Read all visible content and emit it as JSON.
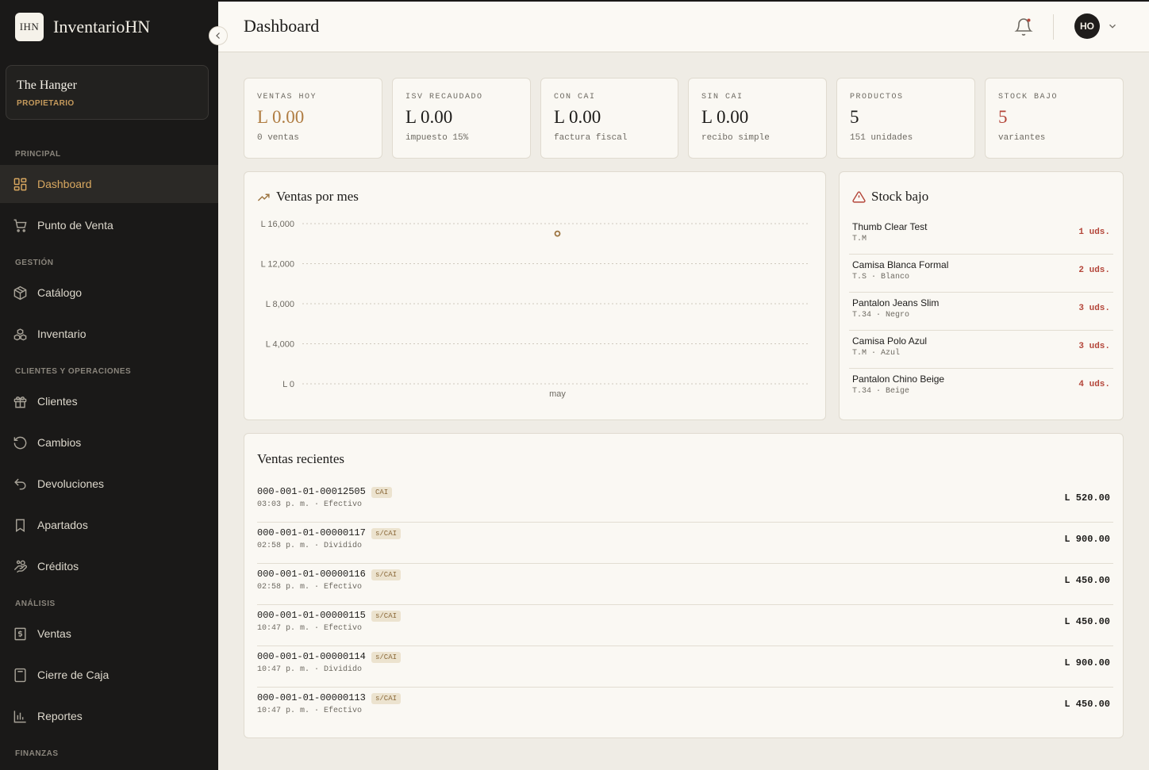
{
  "brand": {
    "logo_text": "IHN",
    "name": "InventarioHN"
  },
  "store": {
    "name": "The Hanger",
    "role": "PROPIETARIO"
  },
  "sidebar": {
    "sections": [
      {
        "label": "PRINCIPAL"
      },
      {
        "label": "GESTIÓN"
      },
      {
        "label": "CLIENTES Y OPERACIONES"
      },
      {
        "label": "ANÁLISIS"
      },
      {
        "label": "FINANZAS"
      }
    ],
    "items": [
      {
        "label": "Dashboard",
        "icon": "dashboard-icon",
        "active": true
      },
      {
        "label": "Punto de Venta",
        "icon": "cart-icon"
      },
      {
        "label": "Catálogo",
        "icon": "package-icon"
      },
      {
        "label": "Inventario",
        "icon": "boxes-icon"
      },
      {
        "label": "Clientes",
        "icon": "gift-icon"
      },
      {
        "label": "Cambios",
        "icon": "rotate-icon"
      },
      {
        "label": "Devoluciones",
        "icon": "undo-icon"
      },
      {
        "label": "Apartados",
        "icon": "bookmark-icon"
      },
      {
        "label": "Créditos",
        "icon": "hand-coins-icon"
      },
      {
        "label": "Ventas",
        "icon": "dollar-receipt-icon"
      },
      {
        "label": "Cierre de Caja",
        "icon": "calculator-icon"
      },
      {
        "label": "Reportes",
        "icon": "bar-chart-icon"
      }
    ]
  },
  "header": {
    "title": "Dashboard",
    "avatar_initials": "HO"
  },
  "stats": [
    {
      "label": "VENTAS HOY",
      "value": "L 0.00",
      "sub": "0 ventas",
      "color": "#b07d43"
    },
    {
      "label": "ISV RECAUDADO",
      "value": "L 0.00",
      "sub": "impuesto 15%",
      "color": "#1c1b19"
    },
    {
      "label": "CON CAI",
      "value": "L 0.00",
      "sub": "factura fiscal",
      "color": "#1c1b19"
    },
    {
      "label": "SIN CAI",
      "value": "L 0.00",
      "sub": "recibo simple",
      "color": "#1c1b19"
    },
    {
      "label": "PRODUCTOS",
      "value": "5",
      "sub": "151 unidades",
      "color": "#1c1b19"
    },
    {
      "label": "STOCK BAJO",
      "value": "5",
      "sub": "variantes",
      "color": "#b4463a"
    }
  ],
  "sales_chart": {
    "title": "Ventas por mes",
    "chart_data": {
      "type": "scatter",
      "categories": [
        "may"
      ],
      "values": [
        15000
      ],
      "ylim": [
        0,
        16000
      ],
      "yticks": [
        "L 16,000",
        "L 12,000",
        "L 8,000",
        "L 4,000",
        "L 0"
      ],
      "ytick_values": [
        16000,
        12000,
        8000,
        4000,
        0
      ],
      "grid": true,
      "color": "#9c7440"
    }
  },
  "stock_low": {
    "title": "Stock bajo",
    "items": [
      {
        "name": "Thumb Clear Test",
        "meta": "T.M",
        "qty": "1 uds."
      },
      {
        "name": "Camisa Blanca Formal",
        "meta": "T.S · Blanco",
        "qty": "2 uds."
      },
      {
        "name": "Pantalon Jeans Slim",
        "meta": "T.34 · Negro",
        "qty": "3 uds."
      },
      {
        "name": "Camisa Polo Azul",
        "meta": "T.M · Azul",
        "qty": "3 uds."
      },
      {
        "name": "Pantalon Chino Beige",
        "meta": "T.34 · Beige",
        "qty": "4 uds."
      }
    ]
  },
  "recent_sales": {
    "title": "Ventas recientes",
    "items": [
      {
        "number": "000-001-01-00012505",
        "badge": "CAI",
        "meta": "03:03 p. m. · Efectivo",
        "amount": "L 520.00"
      },
      {
        "number": "000-001-01-00000117",
        "badge": "s/CAI",
        "meta": "02:58 p. m. · Dividido",
        "amount": "L 900.00"
      },
      {
        "number": "000-001-01-00000116",
        "badge": "s/CAI",
        "meta": "02:58 p. m. · Efectivo",
        "amount": "L 450.00"
      },
      {
        "number": "000-001-01-00000115",
        "badge": "s/CAI",
        "meta": "10:47 p. m. · Efectivo",
        "amount": "L 450.00"
      },
      {
        "number": "000-001-01-00000114",
        "badge": "s/CAI",
        "meta": "10:47 p. m. · Dividido",
        "amount": "L 900.00"
      },
      {
        "number": "000-001-01-00000113",
        "badge": "s/CAI",
        "meta": "10:47 p. m. · Efectivo",
        "amount": "L 450.00"
      }
    ]
  },
  "colors": {
    "accent": "#d9a860",
    "danger": "#b4463a",
    "sidebar_bg": "#1a1918",
    "page_bg": "#efece5"
  }
}
